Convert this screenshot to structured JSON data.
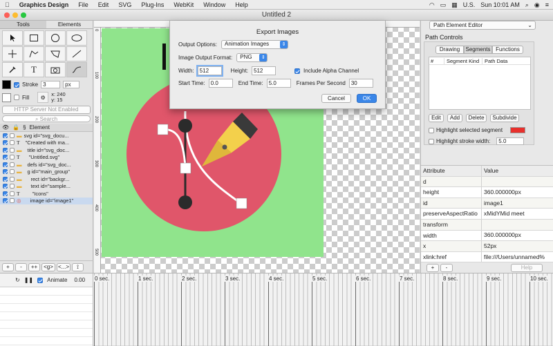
{
  "menubar": {
    "app": "Graphics Design",
    "items": [
      "File",
      "Edit",
      "SVG",
      "Plug-Ins",
      "WebKit",
      "Window",
      "Help"
    ],
    "right": {
      "lang": "U.S.",
      "datetime": "Sun 10:01 AM"
    }
  },
  "window": {
    "title": "Untitled 2"
  },
  "left": {
    "tabs": [
      "Tools",
      "Elements"
    ],
    "stroke_label": "Stroke",
    "stroke_value": "3",
    "stroke_unit": "px",
    "fill_label": "Fill",
    "x_readout": "x: 240",
    "y_readout": "y: 15",
    "server_button": "HTTP Server Not Enabled",
    "search_placeholder": "Search",
    "tree_header": {
      "eye": "👁",
      "lock": "🔒",
      "s": "§",
      "element": "Element"
    },
    "tree": [
      {
        "label": "svg id=\"svg_docu...",
        "indent": 0,
        "type": "folder"
      },
      {
        "label": "\"Created with ma...",
        "indent": 1,
        "type": "text"
      },
      {
        "label": "title id=\"svg_doc...",
        "indent": 1,
        "type": "folder"
      },
      {
        "label": "\"Untitled.svg\"",
        "indent": 2,
        "type": "text"
      },
      {
        "label": "defs id=\"svg_doc...",
        "indent": 1,
        "type": "folder"
      },
      {
        "label": "g id=\"main_group\"",
        "indent": 1,
        "type": "folder"
      },
      {
        "label": "rect id=\"backgr...",
        "indent": 2,
        "type": "folder"
      },
      {
        "label": "text id=\"sample...",
        "indent": 2,
        "type": "folder"
      },
      {
        "label": "\"Icons\"",
        "indent": 3,
        "type": "text"
      },
      {
        "label": "image id=\"image1\"",
        "indent": 2,
        "type": "image",
        "selected": true
      }
    ],
    "bottom_buttons": [
      "+",
      "-",
      "++",
      "<g>",
      "<...>",
      "⟟"
    ]
  },
  "ruler": {
    "left_ticks": [
      "0",
      "100",
      "200",
      "300",
      "400",
      "500"
    ]
  },
  "dialog": {
    "title": "Export Images",
    "output_options_label": "Output Options:",
    "output_options_value": "Animation Images",
    "format_label": "Image Output Format:",
    "format_value": "PNG",
    "width_label": "Width:",
    "width_value": "512",
    "height_label": "Height:",
    "height_value": "512",
    "alpha_label": "Include Alpha Channel",
    "start_label": "Start Time:",
    "start_value": "0.0",
    "end_label": "End Time:",
    "end_value": "5.0",
    "fps_label": "Frames Per Second",
    "fps_value": "30",
    "cancel": "Cancel",
    "ok": "OK"
  },
  "right": {
    "editor_select": "Path Element Editor",
    "path_controls": "Path Controls",
    "tabs": [
      "Drawing",
      "Segments",
      "Functions"
    ],
    "table_headers": [
      "#",
      "Segment Kind",
      "Path Data"
    ],
    "buttons": [
      "Edit",
      "Add",
      "Delete",
      "Subdivide"
    ],
    "highlight_segment": "Highlight selected segment",
    "highlight_stroke": "Highlight stroke width:",
    "highlight_stroke_value": "5.0",
    "highlight_color": "#e8302c",
    "attr_headers": [
      "Attribute",
      "Value"
    ],
    "attributes": [
      {
        "name": "d",
        "value": ""
      },
      {
        "name": "height",
        "value": "360.000000px"
      },
      {
        "name": "id",
        "value": "image1"
      },
      {
        "name": "preserveAspectRatio",
        "value": "xMidYMid meet"
      },
      {
        "name": "transform",
        "value": ""
      },
      {
        "name": "width",
        "value": "360.000000px"
      },
      {
        "name": "x",
        "value": "52px"
      },
      {
        "name": "xlink:href",
        "value": "file:///Users/unnamed%"
      }
    ],
    "add": "+",
    "remove": "-",
    "help": "Help"
  },
  "timeline": {
    "animate_label": "Animate",
    "time_value": "0.00",
    "labels": [
      "0 sec.",
      "1 sec.",
      "2 sec.",
      "3 sec.",
      "4 sec.",
      "5 sec.",
      "6 sec.",
      "7 sec.",
      "8 sec.",
      "9 sec.",
      "10 sec."
    ]
  },
  "colors": {
    "canvas_green": "#90e48c",
    "circle_red": "#e0566a",
    "pen_yellow": "#f3d04b",
    "accent_blue": "#3a86e8"
  }
}
